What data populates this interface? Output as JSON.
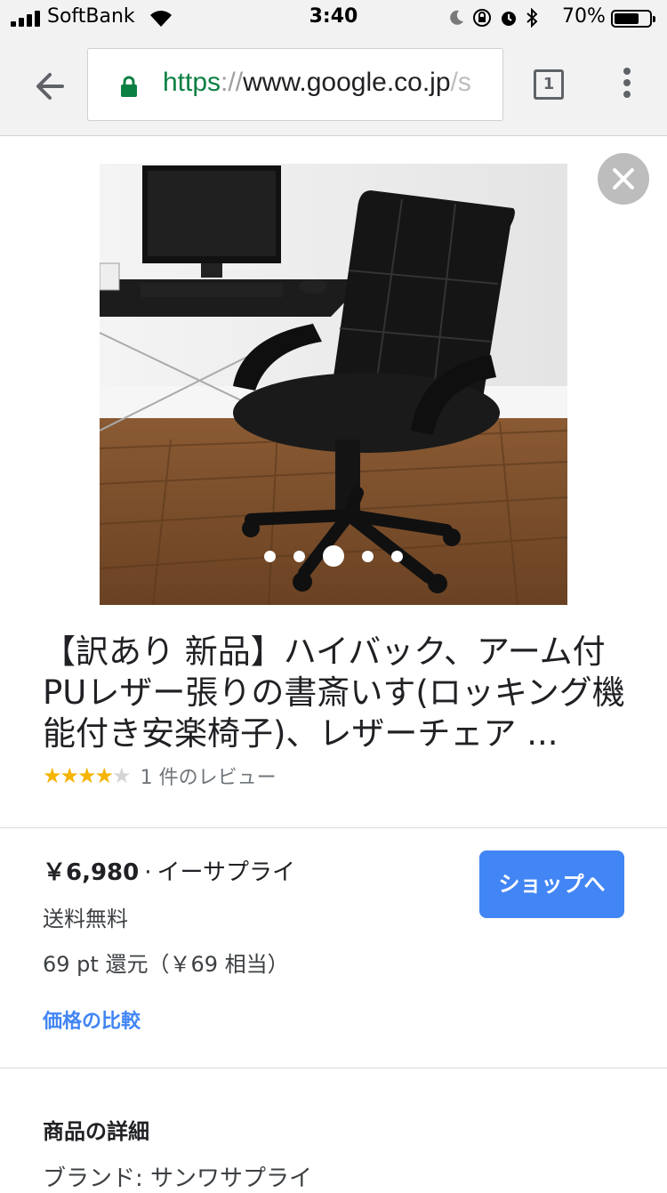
{
  "status_bar": {
    "carrier": "SoftBank",
    "time": "3:40",
    "battery_percent": "70%",
    "battery_level": 0.7
  },
  "browser": {
    "url_scheme": "https",
    "url_separator": "://",
    "url_host": "www.google.co.jp",
    "url_rest": "/s",
    "tab_count": "1"
  },
  "carousel": {
    "image_count": 5,
    "active_index": 2
  },
  "product": {
    "title": "【訳あり 新品】ハイバック、アーム付PUレザー張りの書斎いす(ロッキング機能付き安楽椅子)、レザーチェア ...",
    "rating": 4,
    "rating_max": 5,
    "review_count": "1 件のレビュー",
    "price": "￥6,980",
    "separator": "·",
    "seller": "イーサプライ",
    "shop_button": "ショップへ",
    "shipping": "送料無料",
    "points": "69 pt 還元（￥69 相当）",
    "compare_link": "価格の比較"
  },
  "details": {
    "heading": "商品の詳細",
    "brand_line": "ブランド: サンワサプライ"
  },
  "colors": {
    "accent": "#4285f4",
    "star": "#f5b400",
    "secure": "#0b8043"
  }
}
